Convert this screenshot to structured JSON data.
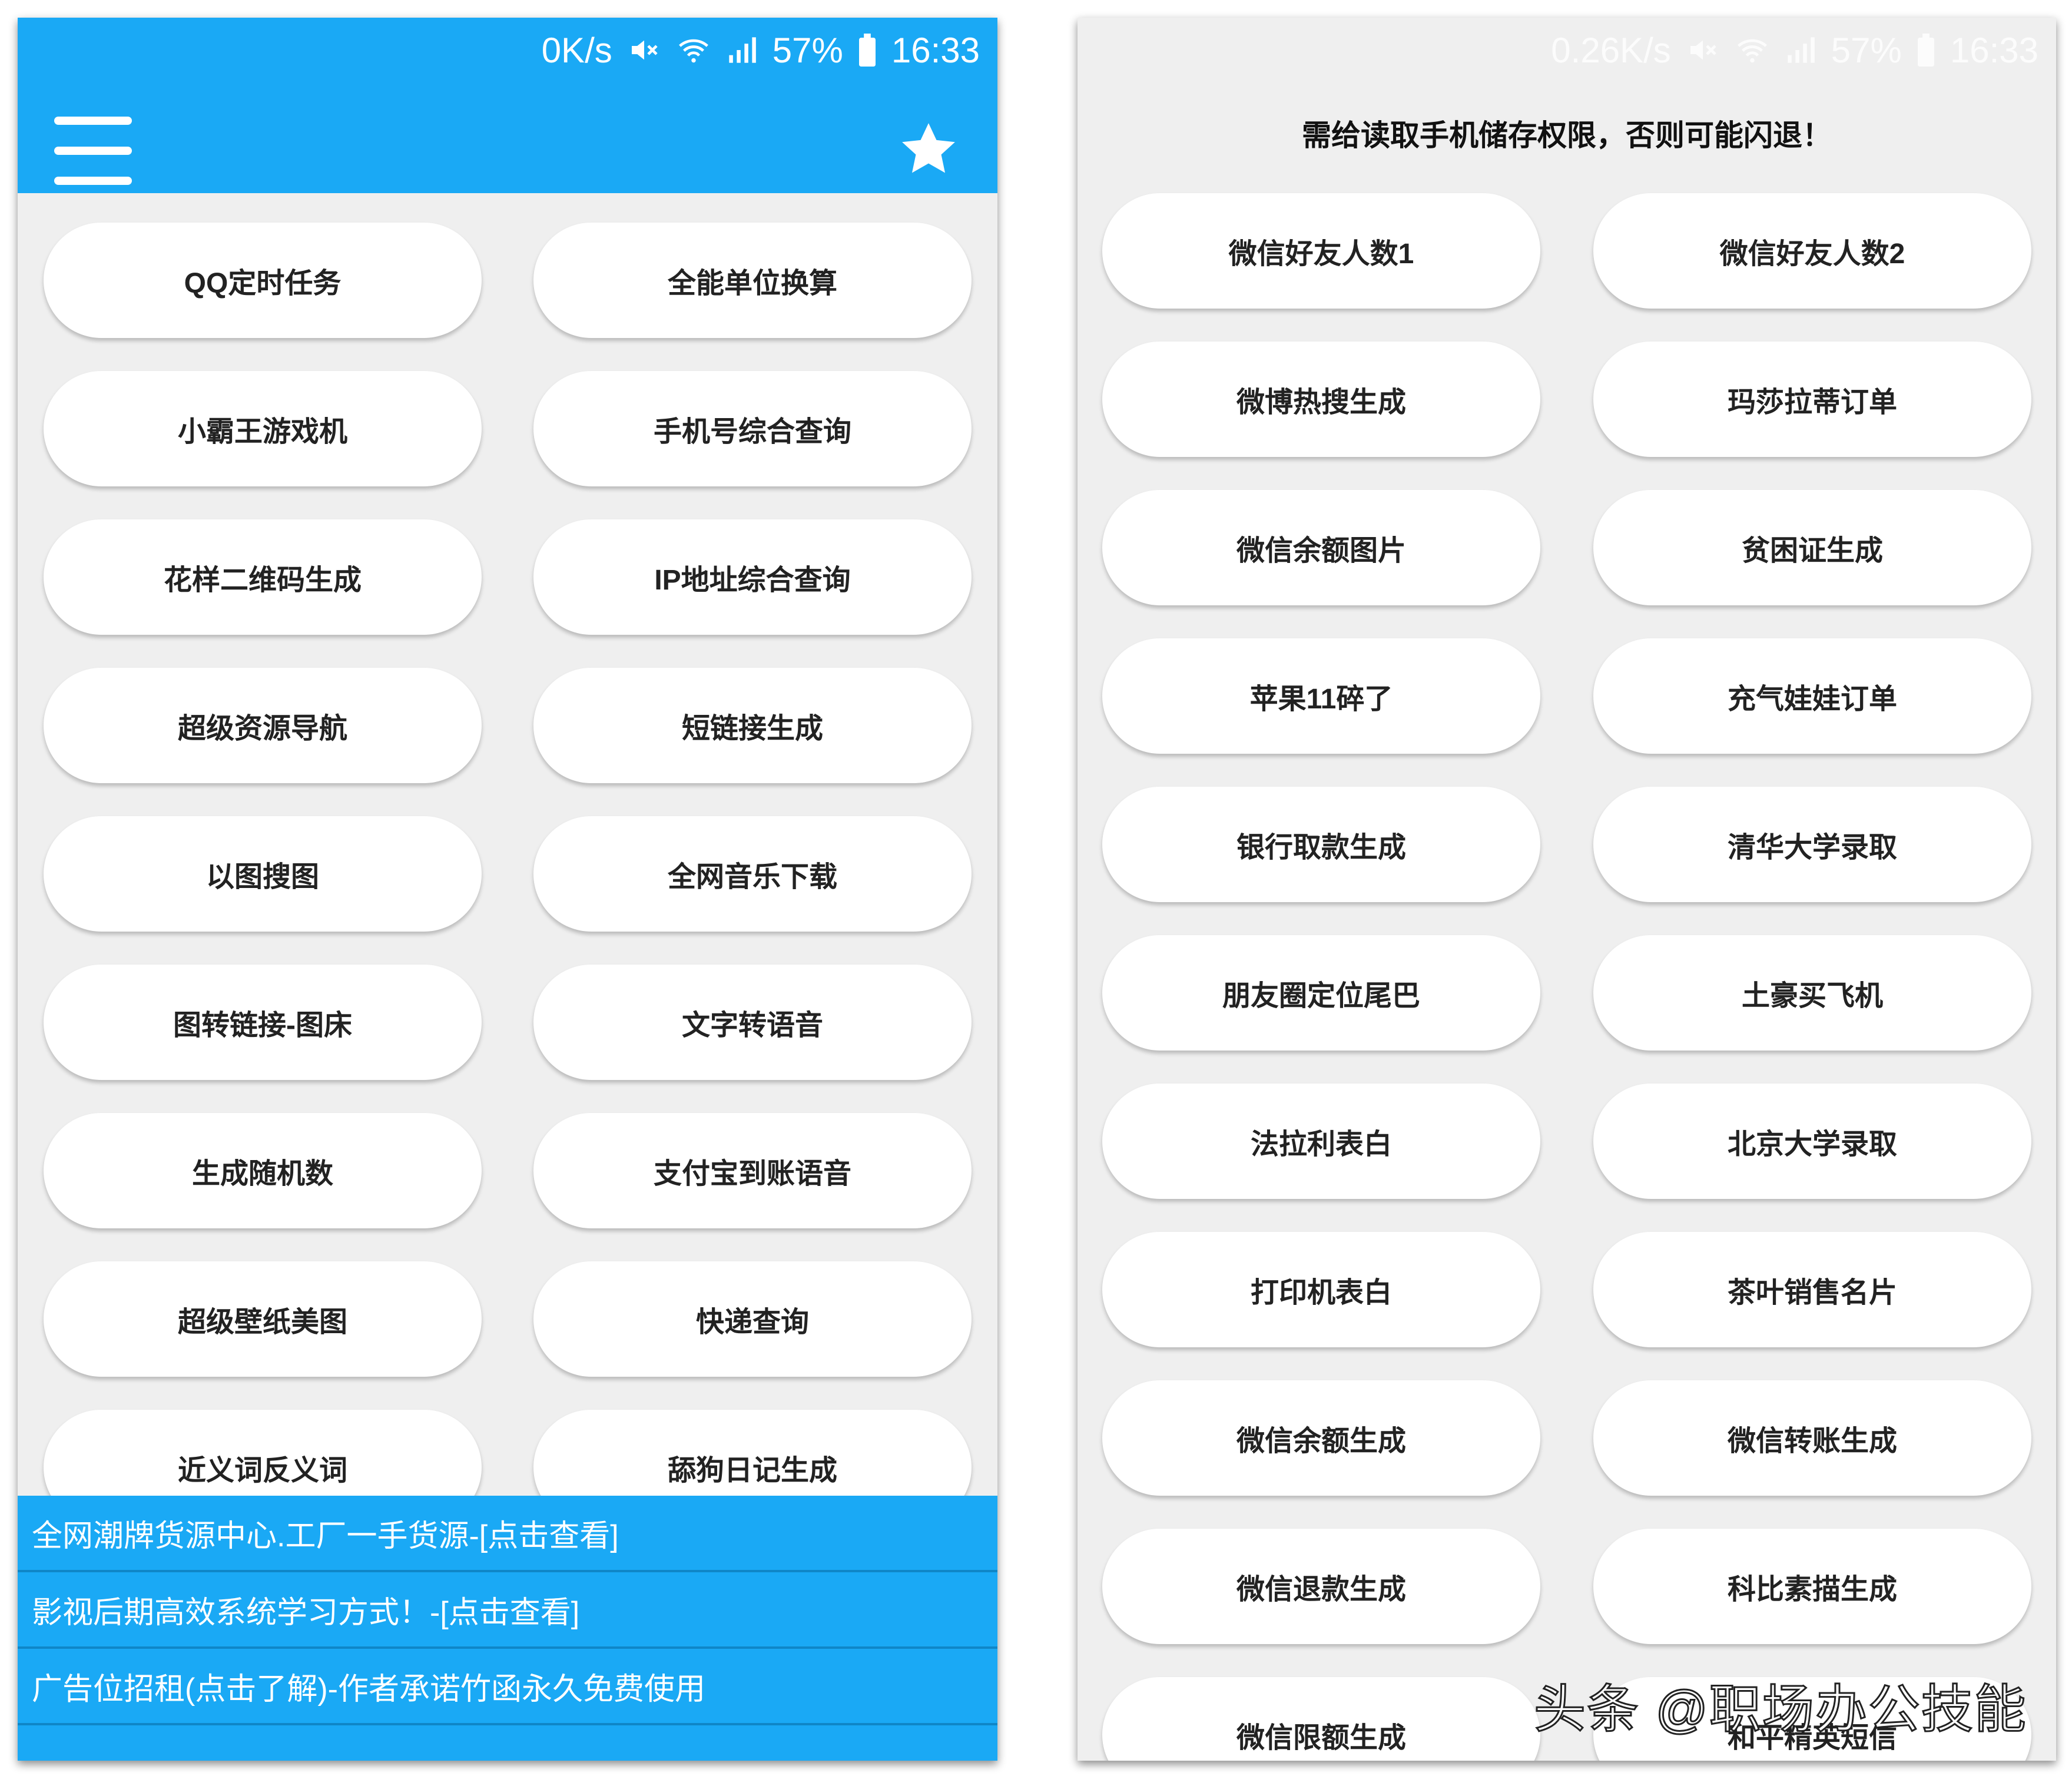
{
  "left_screen": {
    "status": {
      "speed": "0K/s",
      "battery": "57%",
      "time": "16:33"
    },
    "header": {
      "menu_icon": "hamburger-menu-icon",
      "star_icon": "star-icon",
      "color": "#1aa9f5"
    },
    "tools": [
      "QQ定时任务",
      "全能单位换算",
      "小霸王游戏机",
      "手机号综合查询",
      "花样二维码生成",
      "IP地址综合查询",
      "超级资源导航",
      "短链接生成",
      "以图搜图",
      "全网音乐下载",
      "图转链接-图床",
      "文字转语音",
      "生成随机数",
      "支付宝到账语音",
      "超级壁纸美图",
      "快递查询",
      "近义词反义词",
      "舔狗日记生成"
    ],
    "ads": [
      "全网潮牌货源中心.工厂一手货源-[点击查看]",
      "影视后期高效系统学习方式！-[点击查看]",
      "广告位招租(点击了解)-作者承诺竹函永久免费使用"
    ]
  },
  "right_screen": {
    "status": {
      "speed": "0.26K/s",
      "battery": "57%",
      "time": "16:33"
    },
    "notice": "需给读取手机储存权限，否则可能闪退！",
    "tools": [
      "微信好友人数1",
      "微信好友人数2",
      "微博热搜生成",
      "玛莎拉蒂订单",
      "微信余额图片",
      "贫困证生成",
      "苹果11碎了",
      "充气娃娃订单",
      "银行取款生成",
      "清华大学录取",
      "朋友圈定位尾巴",
      "土豪买飞机",
      "法拉利表白",
      "北京大学录取",
      "打印机表白",
      "茶叶销售名片",
      "微信余额生成",
      "微信转账生成",
      "微信退款生成",
      "科比素描生成",
      "微信限额生成",
      "和平精英短信"
    ]
  },
  "watermark": "头条 @职场办公技能"
}
